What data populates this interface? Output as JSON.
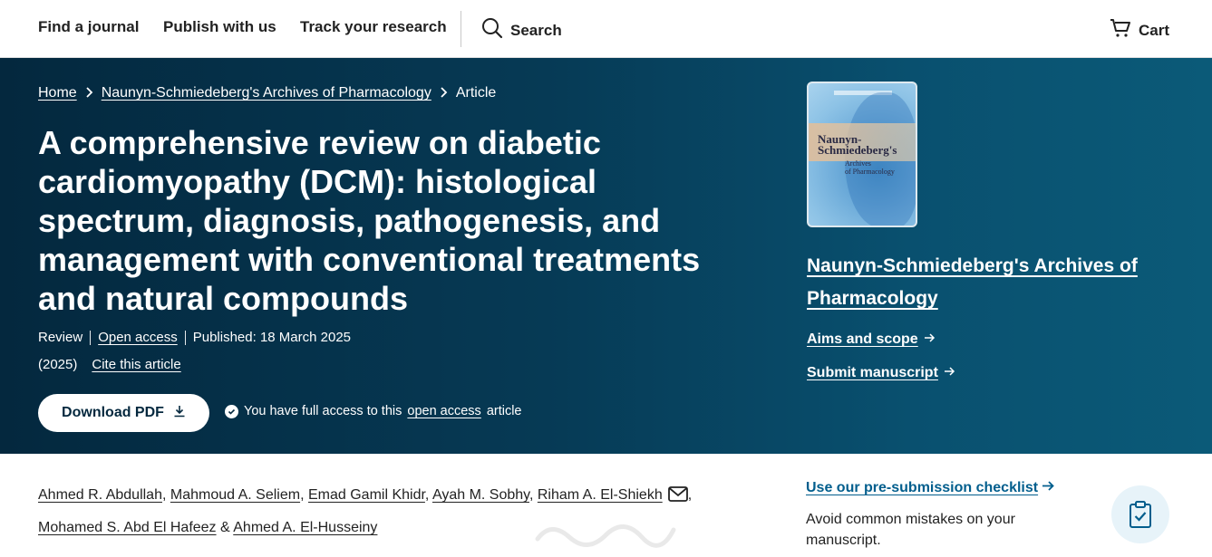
{
  "nav": {
    "links": [
      "Find a journal",
      "Publish with us",
      "Track your research"
    ],
    "search_label": "Search",
    "cart_label": "Cart"
  },
  "breadcrumb": {
    "home": "Home",
    "journal": "Naunyn-Schmiedeberg's Archives of Pharmacology",
    "current": "Article"
  },
  "article": {
    "title": "A comprehensive review on diabetic cardiomyopathy (DCM): histological spectrum, diagnosis, pathogenesis, and management with conventional treatments and natural compounds",
    "type": "Review",
    "open_access": "Open access",
    "published": "Published: 18 March 2025",
    "year": "(2025)",
    "cite": "Cite this article",
    "download_label": "Download PDF",
    "access_prefix": "You have full access to this",
    "access_link": "open access",
    "access_suffix": "article"
  },
  "journal": {
    "cover_title": "Naunyn-Schmiedeberg's",
    "cover_subtitle_1": "Archives",
    "cover_subtitle_2": "of Pharmacology",
    "name": "Naunyn-Schmiedeberg's Archives of Pharmacology",
    "aims": "Aims and scope",
    "submit": "Submit manuscript"
  },
  "authors": {
    "list": [
      "Ahmed R. Abdullah",
      "Mahmoud A. Seliem",
      "Emad Gamil Khidr",
      "Ayah M. Sobhy",
      "Riham A. El-Shiekh",
      "Mohamed S. Abd El Hafeez",
      "Ahmed A. El-Husseiny"
    ],
    "sep": ",",
    "amp": "&"
  },
  "checklist": {
    "link": "Use our pre-submission checklist",
    "desc": "Avoid common mistakes on your manuscript."
  },
  "colors": {
    "hero_dark": "#04283e",
    "hero_light": "#0b5a78",
    "link_blue": "#025e8d"
  }
}
